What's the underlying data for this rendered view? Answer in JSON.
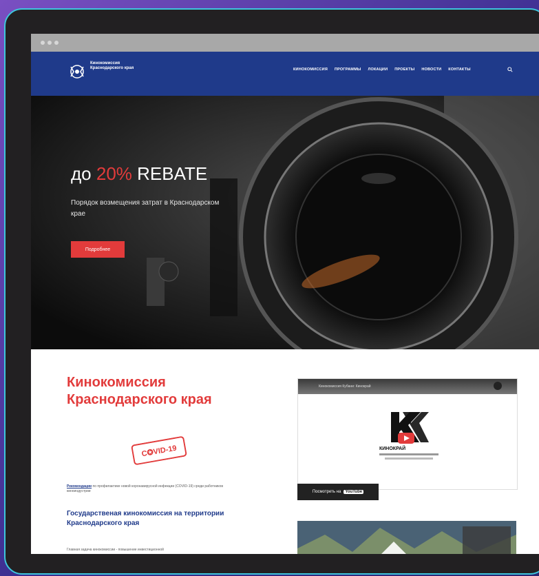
{
  "colors": {
    "brand_blue": "#1f3a8a",
    "accent_red": "#e23b3b"
  },
  "header": {
    "logo_text": "Кинокомиссия Краснодарского края",
    "nav": [
      "КИНОКОМИССИЯ",
      "ПРОГРАММЫ",
      "ЛОКАЦИИ",
      "ПРОЕКТЫ",
      "НОВОСТИ",
      "КОНТАКТЫ"
    ],
    "search_icon": "search-icon"
  },
  "hero": {
    "title_prefix": "до ",
    "title_accent": "20%",
    "title_suffix": " REBATE",
    "subtitle": "Порядок возмещения затрат в Краснодарском крае",
    "button": "Подробнее"
  },
  "intro": {
    "title": "Кинокомиссия Краснодарского края",
    "stamp": "C✪VID-19",
    "para_link": "Рекомендации",
    "para_text": " по профилактике новой коронавирусной инфекции (COVID-19) среди работников киноиндустрии",
    "subtitle": "Государственая кинокомиссия на территории Краснодарского края",
    "para2": "Главная задача кинокомиссии - повышение инвестиционной"
  },
  "video": {
    "title": "Кинокомиссия Кубани: Кинокрай",
    "brand": "КИНОКРАЙ",
    "watch_label": "Посмотреть на",
    "youtube": "YouTube"
  }
}
